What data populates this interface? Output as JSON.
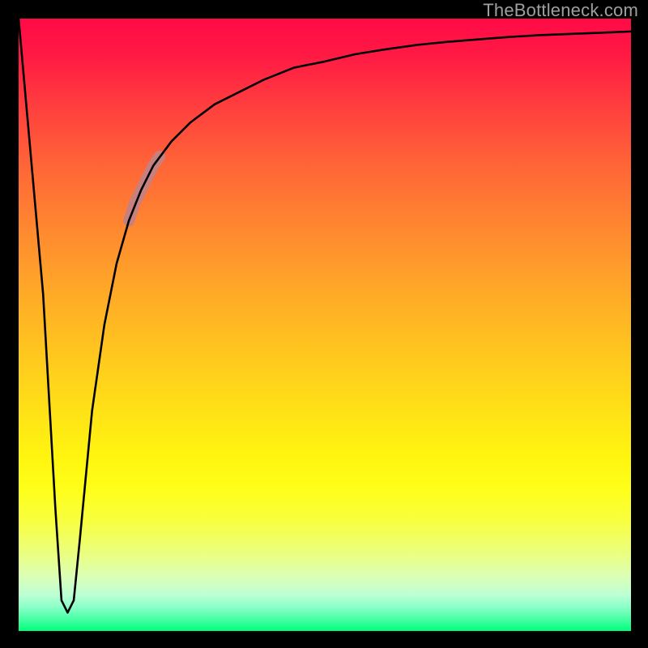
{
  "watermark": {
    "text": "TheBottleneck.com"
  },
  "chart_data": {
    "type": "line",
    "title": "",
    "xlabel": "",
    "ylabel": "",
    "xlim": [
      0,
      100
    ],
    "ylim": [
      0,
      100
    ],
    "grid": false,
    "legend": false,
    "series": [
      {
        "name": "bottleneck-curve",
        "x": [
          0,
          4,
          6,
          7,
          8,
          9,
          10,
          12,
          14,
          16,
          18,
          20,
          22,
          25,
          28,
          32,
          36,
          40,
          45,
          50,
          55,
          60,
          65,
          70,
          75,
          80,
          85,
          90,
          95,
          100
        ],
        "values": [
          100,
          55,
          20,
          5,
          3,
          5,
          15,
          36,
          50,
          60,
          67,
          72,
          76,
          80,
          83,
          86,
          88,
          90,
          92,
          93,
          94.2,
          95,
          95.7,
          96.2,
          96.6,
          97,
          97.3,
          97.5,
          97.7,
          97.9
        ]
      },
      {
        "name": "highlight-segment",
        "x": [
          18,
          19,
          20,
          21,
          22,
          23
        ],
        "values": [
          67,
          70,
          72,
          74,
          76,
          77.5
        ]
      }
    ],
    "colors": {
      "curve_stroke": "#000000",
      "highlight_stroke": "#c5807f",
      "gradient_top": "#ff0a46",
      "gradient_bottom": "#00ff7c"
    }
  }
}
